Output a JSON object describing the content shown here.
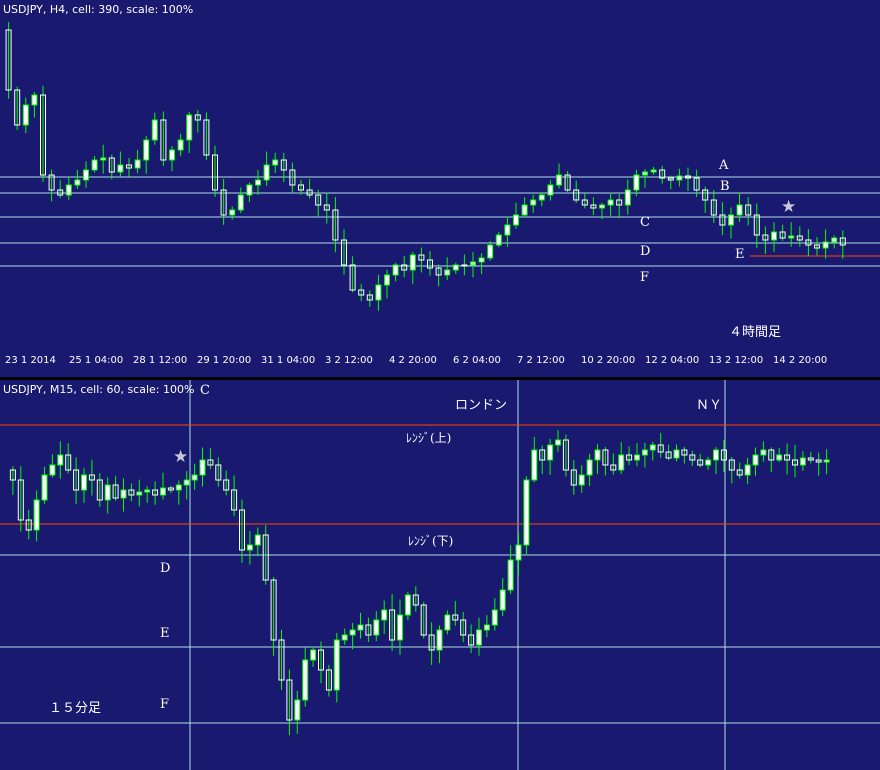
{
  "colors": {
    "background": "#191970",
    "candle_up_body": "#ffffff",
    "candle_down_body": "#ffffff",
    "wick": "#00ff00",
    "level_line": "#b0e0e6",
    "range_line": "#ff4500",
    "divider": "#000000",
    "text": "#ffffff",
    "star": "#c8c8d8"
  },
  "top_chart": {
    "title": "USDJPY, H4, cell: 390, scale: 100%",
    "note": "４時間足",
    "level_labels": [
      "A",
      "B",
      "C",
      "D",
      "E",
      "F"
    ],
    "star_icon": "star-icon",
    "x_ticks": [
      "23 1 2014",
      "25 1 04:00",
      "28 1 12:00",
      "29 1 20:00",
      "31 1 04:00",
      "3 2 12:00",
      "4 2 20:00",
      "6 2 04:00",
      "7 2 12:00",
      "10 2 20:00",
      "12 2 04:00",
      "13 2 12:00",
      "14 2 20:00"
    ]
  },
  "bottom_chart": {
    "title": "USDJPY, M15, cell: 60, scale: 100%",
    "note": "１５分足",
    "session_labels": [
      "C",
      "ロンドン",
      "ＮＹ"
    ],
    "range_labels": {
      "upper": "ﾚﾝｼﾞ(上)",
      "lower": "ﾚﾝｼﾞ(下)"
    },
    "level_labels": [
      "D",
      "E",
      "F"
    ],
    "star_icon": "star-icon"
  },
  "chart_data": [
    {
      "type": "candlestick",
      "title": "USDJPY, H4, cell: 390, scale: 100%",
      "symbol": "USDJPY",
      "timeframe": "H4",
      "x_ticks": [
        "23 1 2014",
        "25 1 04:00",
        "28 1 12:00",
        "29 1 20:00",
        "31 1 04:00",
        "3 2 12:00",
        "4 2 20:00",
        "6 2 04:00",
        "7 2 12:00",
        "10 2 20:00",
        "12 2 04:00",
        "13 2 12:00",
        "14 2 20:00"
      ],
      "horizontal_levels": [
        "A",
        "B",
        "C",
        "D",
        "F"
      ],
      "red_level_label": "E",
      "annotation": "４時間足",
      "grid": false
    },
    {
      "type": "candlestick",
      "title": "USDJPY, M15, cell: 60, scale: 100%",
      "symbol": "USDJPY",
      "timeframe": "M15",
      "session_markers": [
        "C",
        "ロンドン",
        "ＮＹ"
      ],
      "range_upper_label": "ﾚﾝｼﾞ(上)",
      "range_lower_label": "ﾚﾝｼﾞ(下)",
      "horizontal_levels": [
        "D",
        "E",
        "F"
      ],
      "annotation": "１５分足",
      "grid": false
    }
  ]
}
